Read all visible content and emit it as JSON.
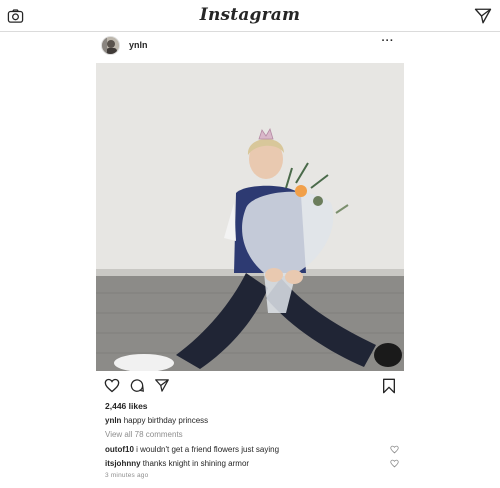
{
  "app": {
    "logo_text": "Instagram"
  },
  "icons": {
    "camera": "camera-icon",
    "direct": "paper-plane-icon",
    "more": "more-options-icon",
    "like": "heart-icon",
    "comment": "comment-icon",
    "share": "share-icon",
    "save": "bookmark-icon"
  },
  "post": {
    "username": "ynln",
    "more_label": "···",
    "likes": "2,446 likes",
    "caption": {
      "user": "ynln",
      "text": "happy birthday princess"
    },
    "view_all": "View all 78 comments",
    "comments": [
      {
        "user": "outof10",
        "text": "i wouldn't get a friend flowers just saying"
      },
      {
        "user": "itsjohnny",
        "text": "thanks knight in shining armor"
      }
    ],
    "timestamp": "3 minutes ago"
  },
  "colors": {
    "text": "#262626",
    "muted": "#8e8e8e",
    "border": "#dbdbdb"
  }
}
